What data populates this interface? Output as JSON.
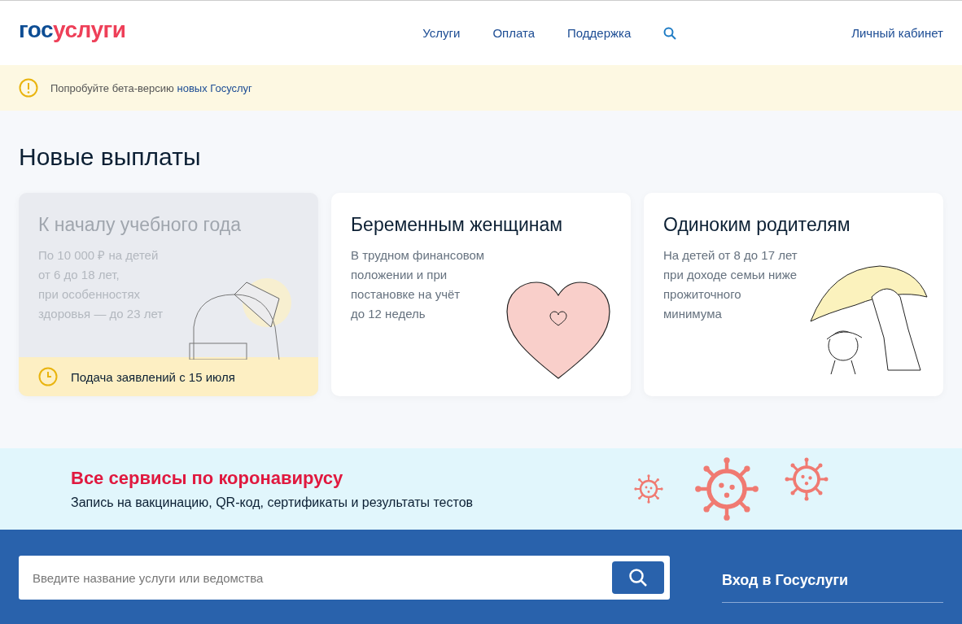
{
  "logo": {
    "prefix": "гос",
    "suffix": "услуги"
  },
  "nav": {
    "links": [
      "Услуги",
      "Оплата",
      "Поддержка"
    ],
    "account": "Личный кабинет"
  },
  "beta_banner": {
    "text": "Попробуйте бета-версию ",
    "link": "новых Госуслуг"
  },
  "section_title": "Новые выплаты",
  "cards": [
    {
      "title": "К началу учебного года",
      "lines": [
        "По 10 000 ₽ на детей",
        "от 6 до 18 лет,",
        "при особенностях",
        "здоровья — до 23 лет"
      ],
      "disabled": true,
      "kind": "backpack",
      "note": "Подача заявлений с 15 июля"
    },
    {
      "title": "Беременным женщинам",
      "lines": [
        "В трудном финансовом",
        "положении и при",
        "постановке на учёт",
        "до 12 недель"
      ],
      "disabled": false,
      "kind": "heart"
    },
    {
      "title": "Одиноким родителям",
      "lines": [
        "На детей от 8 до 17 лет",
        "при доходе семьи ниже",
        "прожиточного",
        "минимума"
      ],
      "disabled": false,
      "kind": "umbrella"
    }
  ],
  "covid": {
    "title": "Все сервисы по коронавирусу",
    "subtitle": "Запись на вакцинацию, QR-код, сертификаты и результаты тестов"
  },
  "search": {
    "placeholder": "Введите название услуги или ведомства"
  },
  "login_link": "Вход в Госуслуги"
}
